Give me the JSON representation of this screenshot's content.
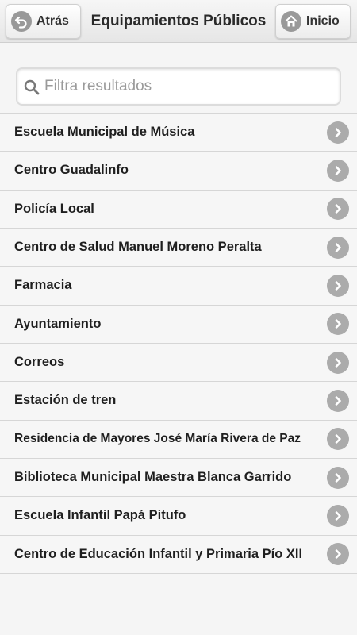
{
  "header": {
    "back_label": "Atrás",
    "title": "Equipamientos Públicos",
    "home_label": "Inicio"
  },
  "search": {
    "placeholder": "Filtra resultados"
  },
  "list": {
    "items": [
      {
        "label": "Escuela Municipal de Música"
      },
      {
        "label": "Centro Guadalinfo"
      },
      {
        "label": "Policía Local"
      },
      {
        "label": "Centro de Salud Manuel Moreno Peralta"
      },
      {
        "label": "Farmacia"
      },
      {
        "label": "Ayuntamiento"
      },
      {
        "label": "Correos"
      },
      {
        "label": "Estación de tren"
      },
      {
        "label": "Residencia de Mayores José María Rivera de Paz"
      },
      {
        "label": "Biblioteca Municipal Maestra Blanca Garrido"
      },
      {
        "label": "Escuela Infantil Papá Pitufo"
      },
      {
        "label": "Centro de Educación Infantil y Primaria Pío XII"
      }
    ]
  },
  "icons": {
    "back": "arrow-back-icon",
    "home": "home-icon",
    "search": "search-icon",
    "item_chevron": "chevron-right-icon"
  },
  "colors": {
    "icon_gray": "#999999",
    "background": "#f5f5f5"
  }
}
